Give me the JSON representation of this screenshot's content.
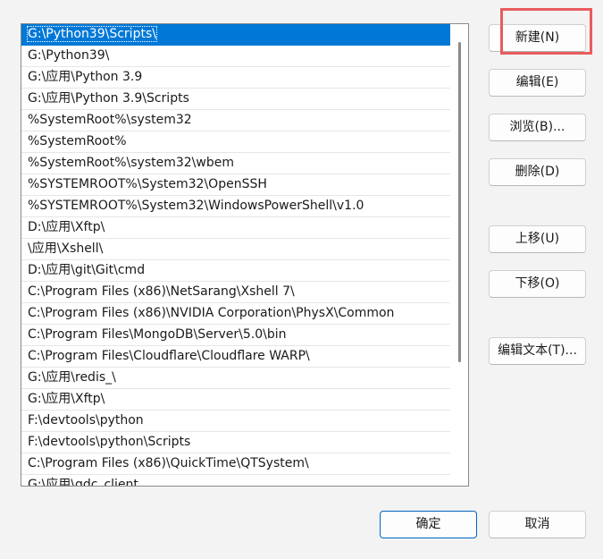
{
  "path_entries": [
    "G:\\Python39\\Scripts\\",
    "G:\\Python39\\",
    "G:\\应用\\Python 3.9",
    "G:\\应用\\Python 3.9\\Scripts",
    "%SystemRoot%\\system32",
    "%SystemRoot%",
    "%SystemRoot%\\system32\\wbem",
    "%SYSTEMROOT%\\System32\\OpenSSH",
    "%SYSTEMROOT%\\System32\\WindowsPowerShell\\v1.0",
    "D:\\应用\\Xftp\\",
    "\\应用\\Xshell\\",
    "D:\\应用\\git\\Git\\cmd",
    "C:\\Program Files (x86)\\NetSarang\\Xshell 7\\",
    "C:\\Program Files (x86)\\NVIDIA Corporation\\PhysX\\Common",
    "C:\\Program Files\\MongoDB\\Server\\5.0\\bin",
    "C:\\Program Files\\Cloudflare\\Cloudflare WARP\\",
    "G:\\应用\\redis_\\",
    "G:\\应用\\Xftp\\",
    "F:\\devtools\\python",
    "F:\\devtools\\python\\Scripts",
    "C:\\Program Files (x86)\\QuickTime\\QTSystem\\",
    "G:\\应用\\gdc_client"
  ],
  "selected_index": 0,
  "buttons": {
    "new": "新建(N)",
    "edit": "编辑(E)",
    "browse": "浏览(B)...",
    "delete": "删除(D)",
    "move_up": "上移(U)",
    "move_down": "下移(O)",
    "edit_text": "编辑文本(T)...",
    "ok": "确定",
    "cancel": "取消"
  },
  "colors": {
    "selection": "#0078d7",
    "highlight_box": "#e85c5c",
    "primary_border": "#0067c0"
  }
}
